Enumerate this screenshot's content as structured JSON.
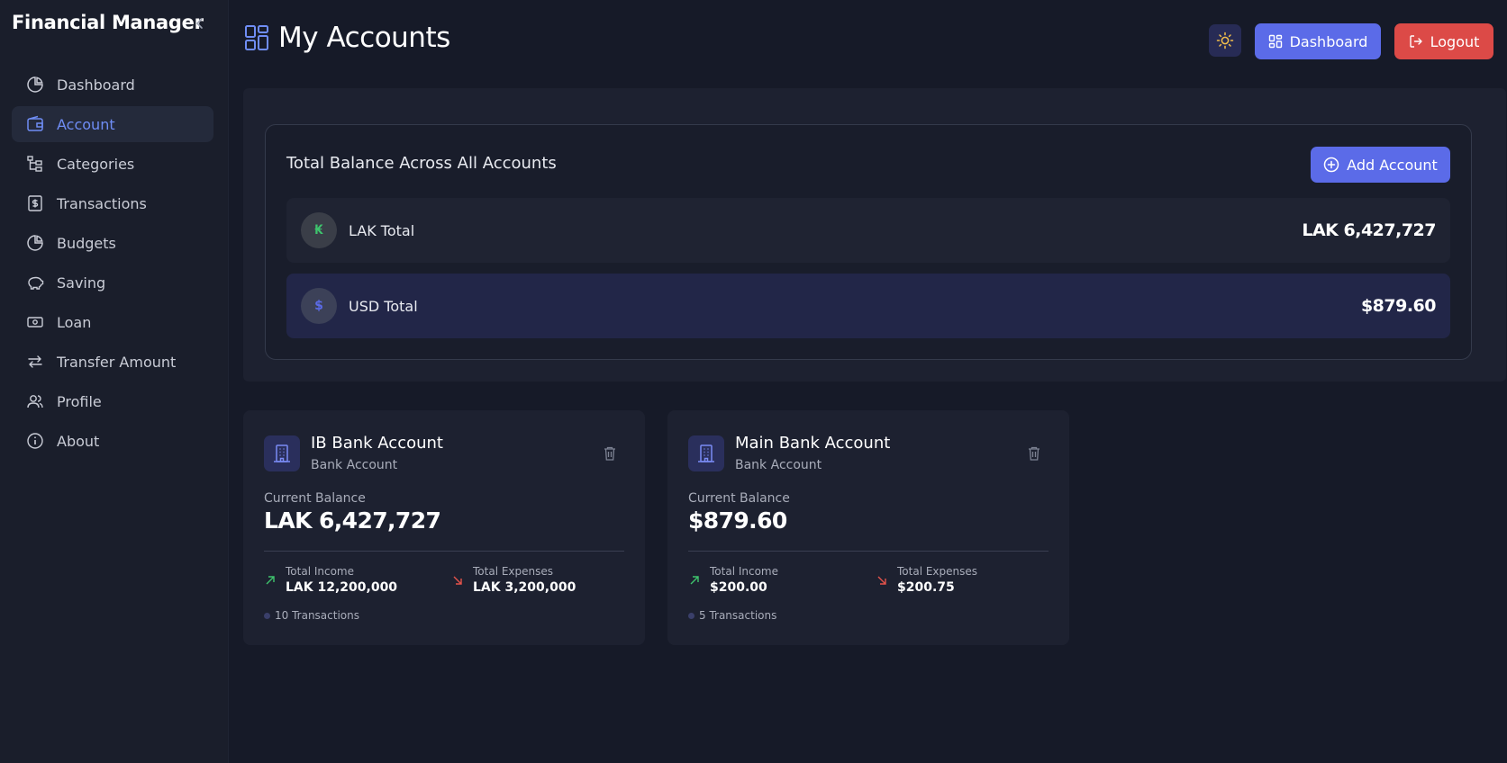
{
  "app": {
    "title": "Financial Manager"
  },
  "sidebar": {
    "items": [
      {
        "label": "Dashboard",
        "icon": "pie-chart-icon",
        "active": false
      },
      {
        "label": "Account",
        "icon": "wallet-icon",
        "active": true
      },
      {
        "label": "Categories",
        "icon": "category-tree-icon",
        "active": false
      },
      {
        "label": "Transactions",
        "icon": "receipt-dollar-icon",
        "active": false
      },
      {
        "label": "Budgets",
        "icon": "pie-chart-icon",
        "active": false
      },
      {
        "label": "Saving",
        "icon": "piggy-bank-icon",
        "active": false
      },
      {
        "label": "Loan",
        "icon": "banknote-icon",
        "active": false
      },
      {
        "label": "Transfer Amount",
        "icon": "transfer-arrows-icon",
        "active": false
      },
      {
        "label": "Profile",
        "icon": "users-icon",
        "active": false
      },
      {
        "label": "About",
        "icon": "info-icon",
        "active": false
      }
    ]
  },
  "header": {
    "title": "My Accounts",
    "dashboard_label": "Dashboard",
    "logout_label": "Logout"
  },
  "summary": {
    "title": "Total Balance Across All Accounts",
    "add_label": "Add Account",
    "totals": [
      {
        "symbol": "₭",
        "label": "LAK Total",
        "amount": "LAK 6,427,727"
      },
      {
        "symbol": "$",
        "label": "USD Total",
        "amount": "$879.60"
      }
    ]
  },
  "accounts": [
    {
      "name": "IB Bank Account",
      "type": "Bank Account",
      "balance_label": "Current Balance",
      "balance": "LAK 6,427,727",
      "income_label": "Total Income",
      "income": "LAK 12,200,000",
      "expense_label": "Total Expenses",
      "expense": "LAK 3,200,000",
      "transactions": "10 Transactions"
    },
    {
      "name": "Main Bank Account",
      "type": "Bank Account",
      "balance_label": "Current Balance",
      "balance": "$879.60",
      "income_label": "Total Income",
      "income": "$200.00",
      "expense_label": "Total Expenses",
      "expense": "$200.75",
      "transactions": "5 Transactions"
    }
  ],
  "colors": {
    "accent": "#5b6be8",
    "danger": "#dc4a47",
    "active_nav_text": "#6f8df5",
    "income": "#3ec46d",
    "expense": "#e5534b"
  }
}
